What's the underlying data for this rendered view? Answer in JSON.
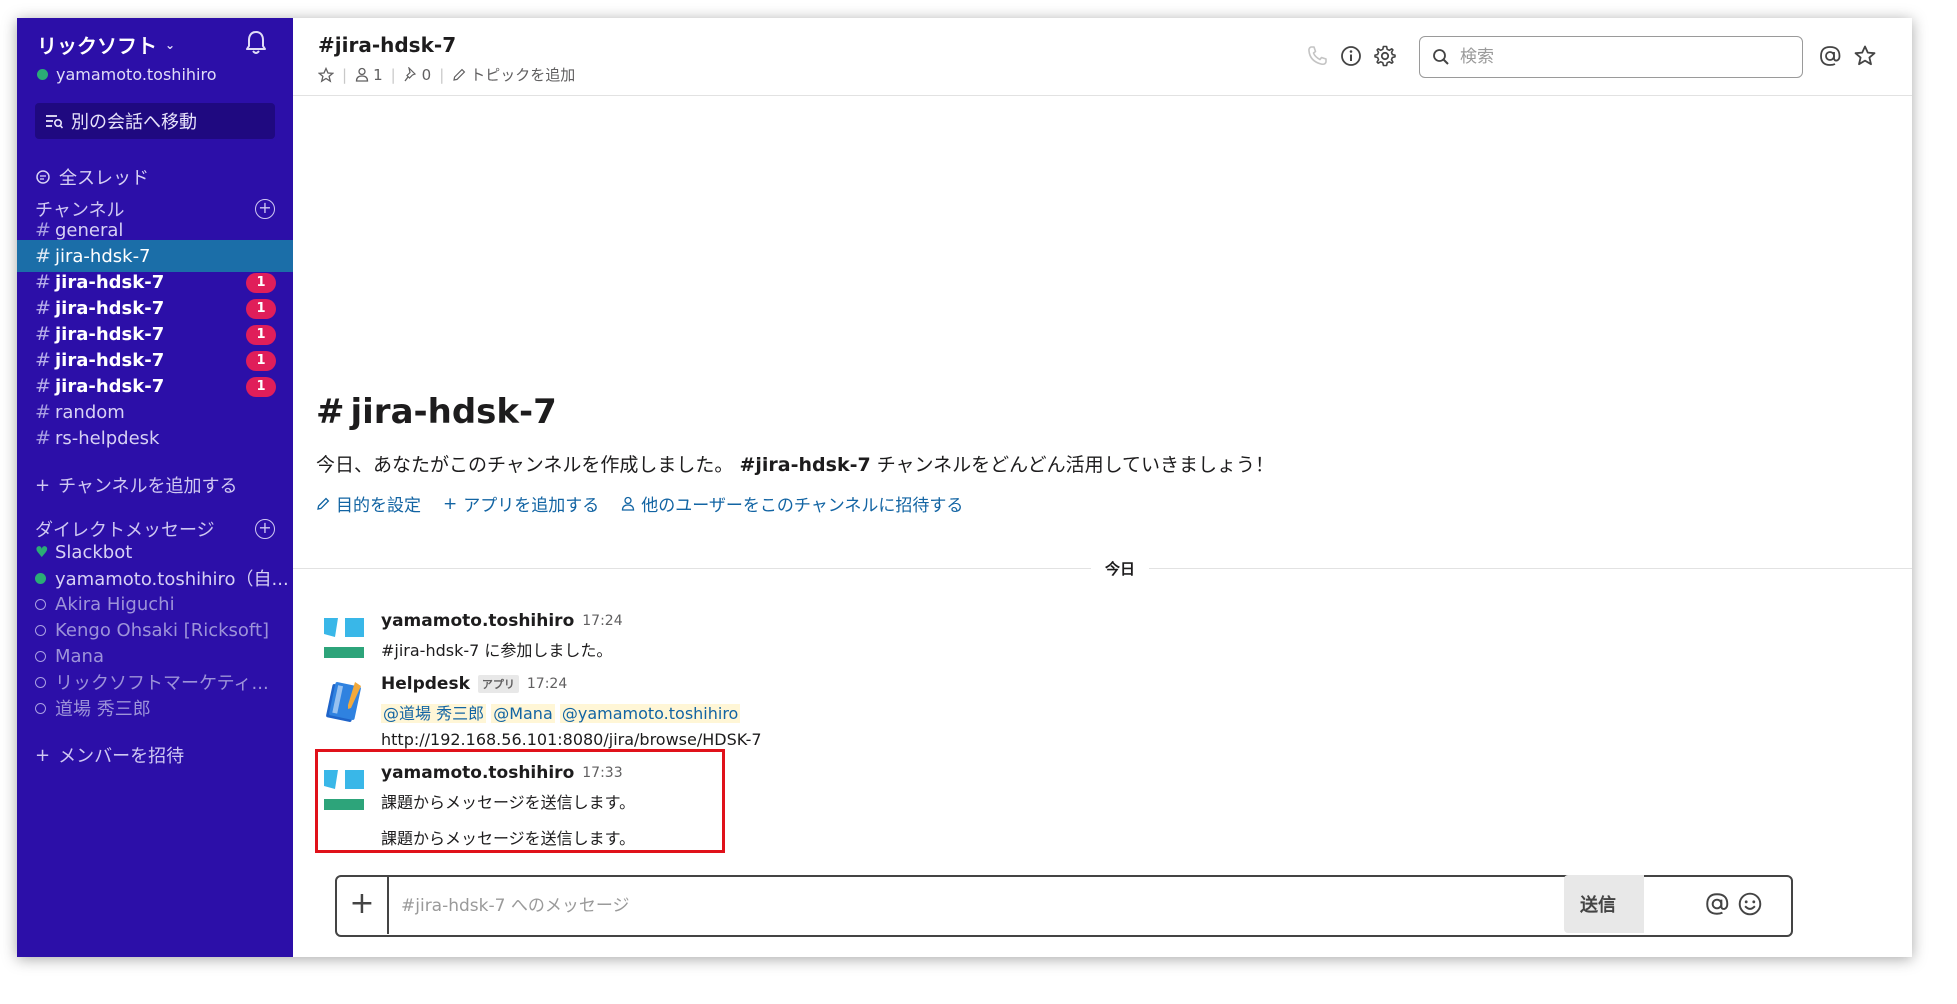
{
  "sidebar": {
    "workspace": "リックソフト",
    "workspace_caret": "⌄",
    "user": "yamamoto.toshihiro",
    "jump_to": "別の会話へ移動",
    "all_threads": "全スレッド",
    "channels_header": "チャンネル",
    "channels": [
      {
        "name": "general",
        "badge": ""
      },
      {
        "name": "jira-hdsk-7",
        "badge": ""
      },
      {
        "name": "jira-hdsk-7",
        "badge": "1"
      },
      {
        "name": "jira-hdsk-7",
        "badge": "1"
      },
      {
        "name": "jira-hdsk-7",
        "badge": "1"
      },
      {
        "name": "jira-hdsk-7",
        "badge": "1"
      },
      {
        "name": "jira-hdsk-7",
        "badge": "1"
      },
      {
        "name": "random",
        "badge": ""
      },
      {
        "name": "rs-helpdesk",
        "badge": ""
      }
    ],
    "add_channel": "チャンネルを追加する",
    "dm_header": "ダイレクトメッセージ",
    "dms": [
      {
        "name": "Slackbot"
      },
      {
        "name": "yamamoto.toshihiro（自..."
      },
      {
        "name": "Akira Higuchi"
      },
      {
        "name": "Kengo Ohsaki [Ricksoft]"
      },
      {
        "name": "Mana"
      },
      {
        "name": "リックソフトマーケティ..."
      },
      {
        "name": "道場 秀三郎"
      }
    ],
    "invite": "メンバーを招待"
  },
  "header": {
    "channel": "#jira-hdsk-7",
    "members": "1",
    "pins": "0",
    "add_topic": "トピックを追加",
    "search_placeholder": "検索"
  },
  "intro": {
    "hash": "#",
    "title": "jira-hdsk-7",
    "text_before": "今日、あなたがこのチャンネルを作成しました。",
    "text_channel": "#jira-hdsk-7",
    "text_after": "チャンネルをどんどん活用していきましょう！",
    "link_purpose": "目的を設定",
    "link_apps": "アプリを追加する",
    "link_invite": "他のユーザーをこのチャンネルに招待する"
  },
  "day_label": "今日",
  "messages": [
    {
      "author": "yamamoto.toshihiro",
      "time": "17:24",
      "lines": [
        "#jira-hdsk-7 に参加しました。"
      ]
    },
    {
      "author": "Helpdesk",
      "tag": "アプリ",
      "time": "17:24",
      "mentions": [
        "@道場 秀三郎",
        "@Mana",
        "@yamamoto.toshihiro"
      ],
      "link": "http://192.168.56.101:8080/jira/browse/HDSK-7"
    },
    {
      "author": "yamamoto.toshihiro",
      "time": "17:33",
      "lines": [
        "課題からメッセージを送信します。",
        "課題からメッセージを送信します。"
      ]
    }
  ],
  "composer": {
    "placeholder": "#jira-hdsk-7 へのメッセージ",
    "send": "送信"
  },
  "colors": {
    "sidebar_bg": "#2c0fa8",
    "active_channel": "#1b6ea8",
    "badge": "#e01e5a",
    "presence": "#2bac76",
    "link": "#1264a3",
    "highlight": "#e0111a"
  }
}
